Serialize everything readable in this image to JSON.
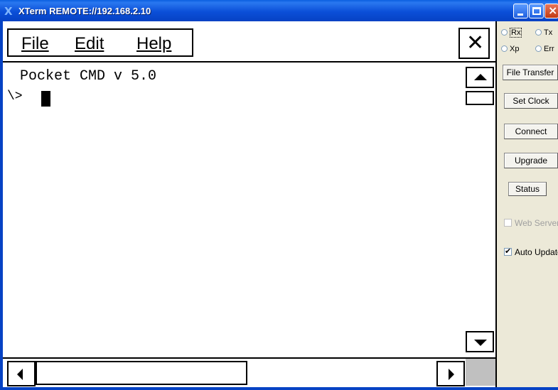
{
  "window": {
    "title": "XTerm REMOTE://192.168.2.10",
    "icon": "x-icon"
  },
  "menu": {
    "file": "File",
    "edit": "Edit",
    "help": "Help"
  },
  "console": {
    "lines": [
      "Pocket CMD v 5.0",
      "\\>"
    ]
  },
  "panel": {
    "radios": [
      {
        "label": "Rx",
        "checked": false
      },
      {
        "label": "Tx",
        "checked": false
      },
      {
        "label": "Xp",
        "checked": false
      },
      {
        "label": "Err",
        "checked": false
      }
    ],
    "buttons": {
      "file_transfer": "File Transfer",
      "set_clock": "Set Clock",
      "connect": "Connect",
      "upgrade": "Upgrade",
      "status": "Status"
    },
    "checkboxes": {
      "web_server": {
        "label": "Web Server",
        "checked": false,
        "enabled": false
      },
      "auto_update": {
        "label": "Auto Update",
        "checked": true,
        "enabled": true
      }
    }
  },
  "colors": {
    "titlebar": "#0b4fd8",
    "screen_bg": "#ffffff",
    "panel_bg": "#ece9d8"
  }
}
